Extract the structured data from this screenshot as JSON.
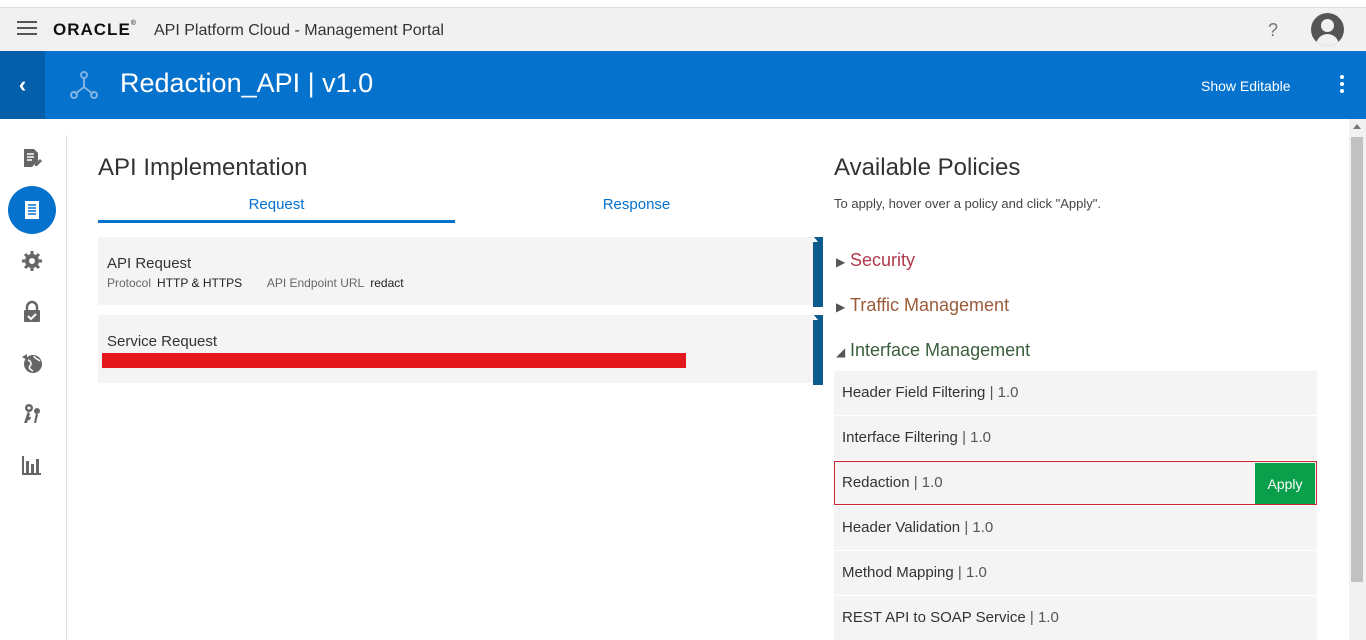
{
  "topbar": {
    "logo": "ORACLE",
    "app_title": "API Platform Cloud - Management Portal",
    "help": "?"
  },
  "header": {
    "title": "Redaction_API | v1.0",
    "show_editable": "Show Editable"
  },
  "implementation": {
    "title": "API Implementation",
    "tabs": [
      {
        "label": "Request",
        "active": true
      },
      {
        "label": "Response",
        "active": false
      }
    ],
    "api_request": {
      "title": "API Request",
      "protocol_label": "Protocol",
      "protocol_value": "HTTP & HTTPS",
      "endpoint_label": "API Endpoint URL",
      "endpoint_value": "redact"
    },
    "service_request": {
      "title": "Service Request"
    }
  },
  "policies": {
    "title": "Available Policies",
    "hint": "To apply, hover over a policy and click \"Apply\".",
    "categories": [
      {
        "label": "Security",
        "expanded": false
      },
      {
        "label": "Traffic Management",
        "expanded": false
      },
      {
        "label": "Interface Management",
        "expanded": true
      }
    ],
    "items": [
      {
        "name": "Header Field Filtering",
        "version": "1.0"
      },
      {
        "name": "Interface Filtering",
        "version": "1.0"
      },
      {
        "name": "Redaction",
        "version": "1.0",
        "selected": true
      },
      {
        "name": "Header Validation",
        "version": "1.0"
      },
      {
        "name": "Method Mapping",
        "version": "1.0"
      },
      {
        "name": "REST API to SOAP Service",
        "version": "1.0"
      }
    ],
    "apply_label": "Apply"
  },
  "colors": {
    "brand_blue": "#0572ce",
    "apply_green": "#0aa04b",
    "selected_border": "#c9262f",
    "redaction_mark": "#e4171f"
  }
}
